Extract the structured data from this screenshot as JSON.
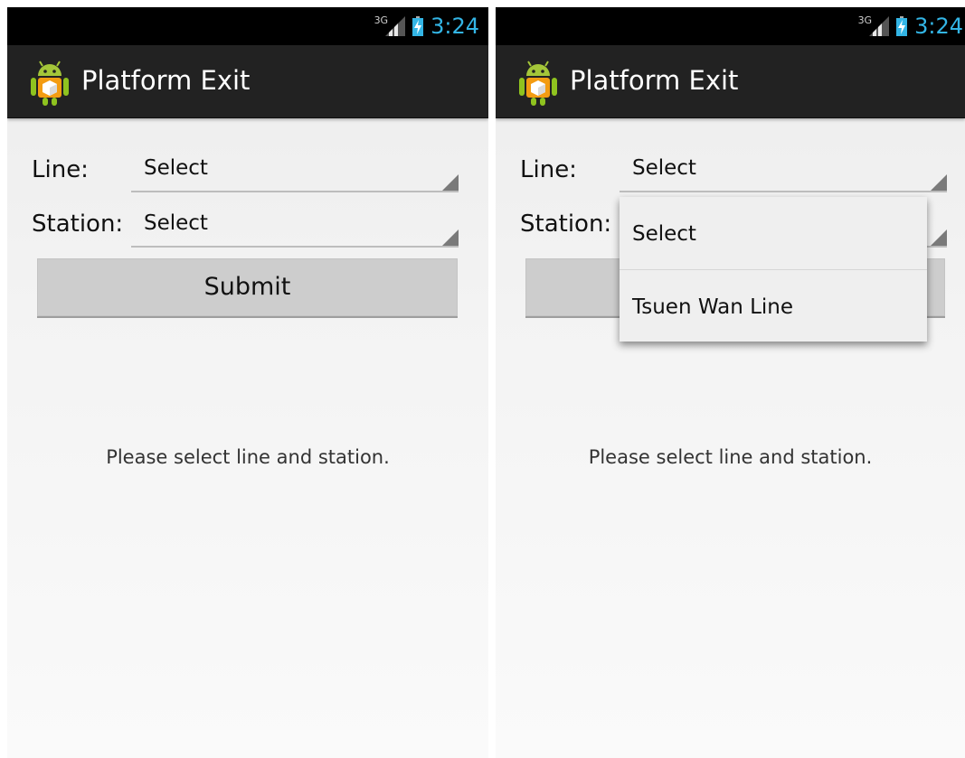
{
  "status_bar": {
    "network_type": "3G",
    "time": "3:24",
    "clock_color": "#33b5e5",
    "icons": [
      "signal-icon",
      "battery-charging-icon"
    ]
  },
  "action_bar": {
    "logo_icon": "android-app-icon",
    "title": "Platform Exit",
    "background_color": "#222222"
  },
  "form": {
    "line_label": "Line:",
    "line_value": "Select",
    "station_label": "Station:",
    "station_value": "Select",
    "submit_label": "Submit"
  },
  "message": "Please select line and station.",
  "line_dropdown": {
    "options": [
      "Select",
      "Tsuen Wan Line"
    ]
  }
}
